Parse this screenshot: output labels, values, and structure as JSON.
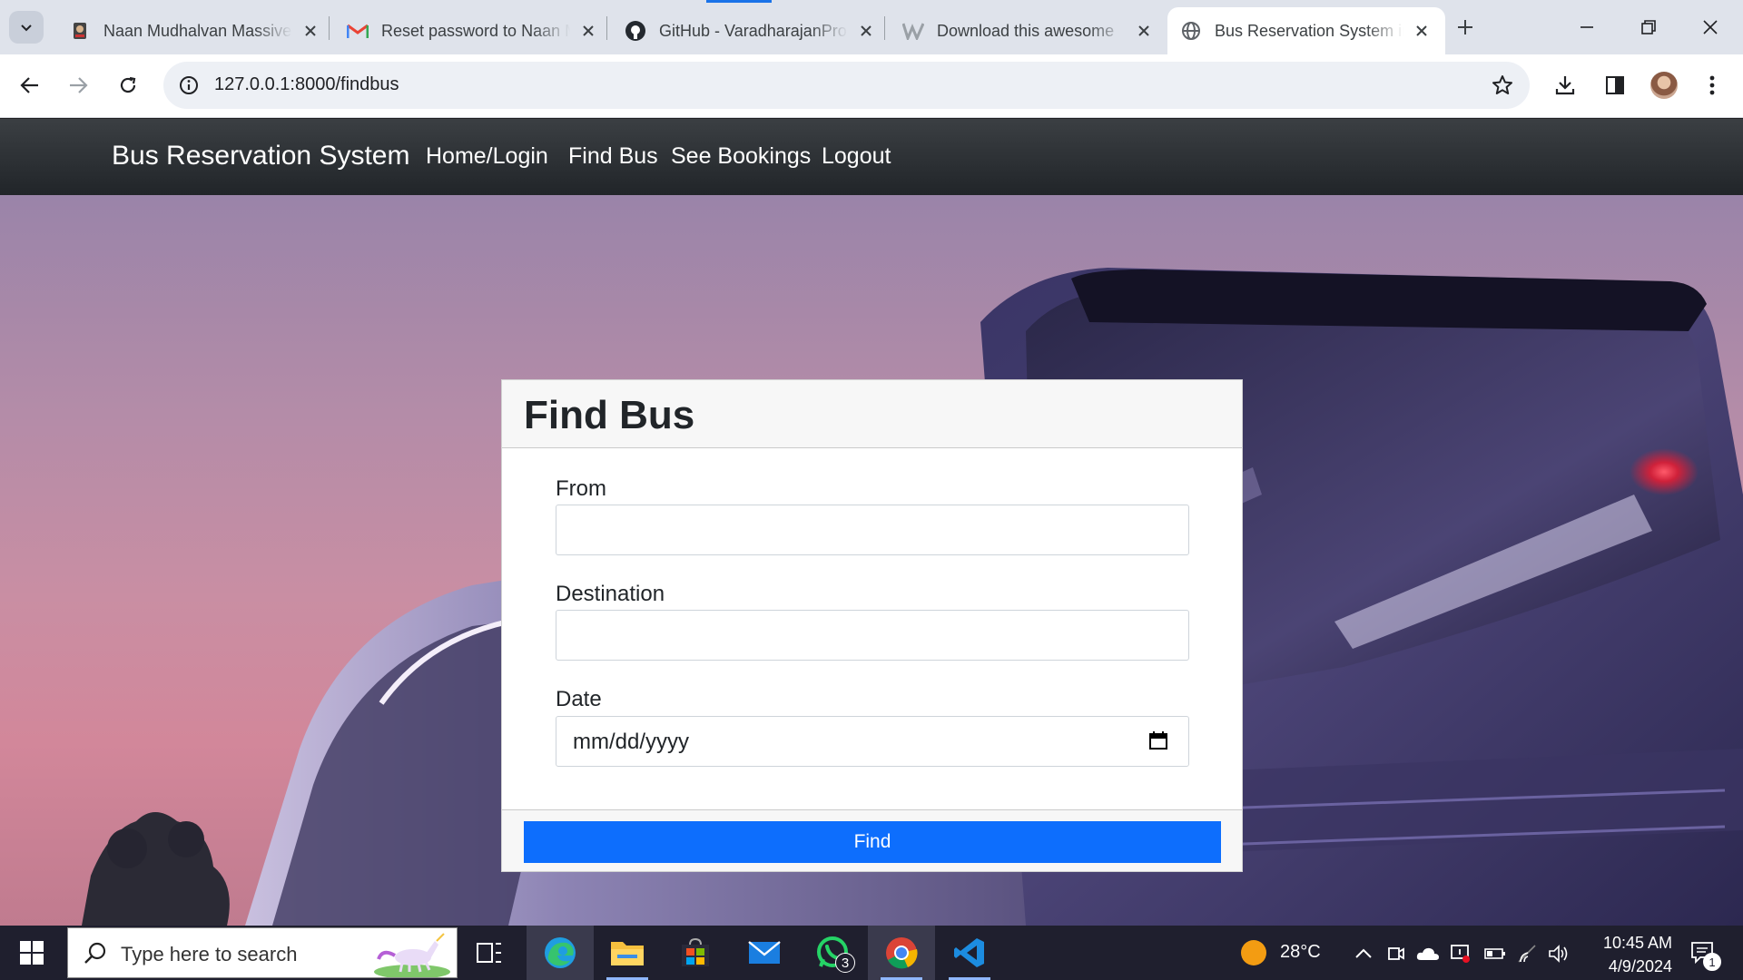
{
  "browser": {
    "tabs": [
      {
        "title": "Naan Mudhalvan Massive",
        "icon": "naan-mudhalvan-favicon"
      },
      {
        "title": "Reset password to Naan M",
        "icon": "gmail-favicon"
      },
      {
        "title": "GitHub - VaradharajanPro",
        "icon": "github-favicon"
      },
      {
        "title": "Download this awesome",
        "icon": "w-favicon"
      },
      {
        "title": "Bus Reservation System in",
        "icon": "globe-favicon",
        "active": true
      }
    ],
    "url": "127.0.0.1:8000/findbus"
  },
  "navbar": {
    "brand": "Bus Reservation System",
    "links": [
      "Home/Login",
      "Find Bus",
      "See Bookings",
      "Logout"
    ]
  },
  "form": {
    "title": "Find Bus",
    "from_label": "From",
    "from_value": "",
    "destination_label": "Destination",
    "destination_value": "",
    "date_label": "Date",
    "date_placeholder": "mm/dd/yyyy",
    "submit_label": "Find"
  },
  "taskbar": {
    "search_placeholder": "Type here to search",
    "whatsapp_badge": "3",
    "weather": "28°C",
    "time": "10:45 AM",
    "date": "4/9/2024",
    "notification_count": "1"
  },
  "colors": {
    "navbar": "#212529",
    "primary": "#0d6efd",
    "card_header": "#f7f7f7"
  }
}
